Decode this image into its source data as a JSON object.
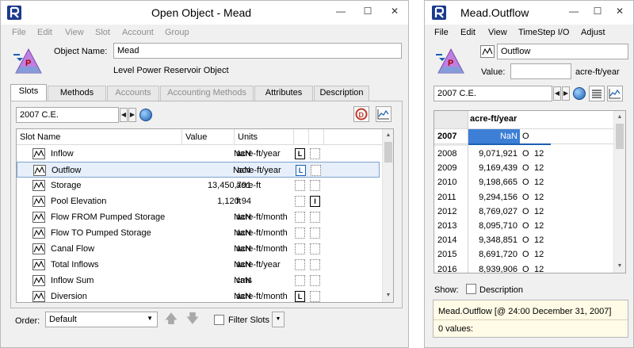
{
  "colors": {
    "accent": "#1a5fb0",
    "selection": "#e6effa",
    "status_bg": "#fffbe6",
    "object_icon_purple": "#c07fe0",
    "object_icon_blue": "#7aa0d8"
  },
  "main_window": {
    "title": "Open Object - Mead",
    "app_icon": "riverware-logo-icon",
    "menu": [
      "File",
      "Edit",
      "View",
      "Slot",
      "Account",
      "Group"
    ],
    "object_name_label": "Object Name:",
    "object_name_value": "Mead",
    "object_type": "Level Power Reservoir Object",
    "tabs": [
      "Slots",
      "Methods",
      "Accounts",
      "Accounting Methods",
      "Attributes",
      "Description"
    ],
    "active_tab": "Slots",
    "timestep": "2007 C.E.",
    "columns": [
      "Slot Name",
      "Value",
      "Units"
    ],
    "slots": [
      {
        "name": "Inflow",
        "value": "NaN",
        "units": "acre-ft/year",
        "flags": [
          "L",
          "e"
        ]
      },
      {
        "name": "Outflow",
        "value": "NaN",
        "units": "acre-ft/year",
        "flags": [
          "L",
          "e"
        ],
        "selected": true
      },
      {
        "name": "Storage",
        "value": "13,450,791",
        "units": "acre-ft",
        "flags": [
          "e",
          "e"
        ]
      },
      {
        "name": "Pool Elevation",
        "value": "1,120.94",
        "units": "ft",
        "flags": [
          "e",
          "I"
        ]
      },
      {
        "name": "Flow FROM Pumped Storage",
        "value": "NaN",
        "units": "acre-ft/month",
        "flags": [
          "e",
          "e"
        ]
      },
      {
        "name": "Flow TO Pumped Storage",
        "value": "NaN",
        "units": "acre-ft/month",
        "flags": [
          "e",
          "e"
        ]
      },
      {
        "name": "Canal Flow",
        "value": "NaN",
        "units": "acre-ft/month",
        "flags": [
          "e",
          "e"
        ]
      },
      {
        "name": "Total Inflows",
        "value": "NaN",
        "units": "acre-ft/year",
        "flags": [
          "e",
          "e"
        ]
      },
      {
        "name": "Inflow Sum",
        "value": "NaN",
        "units": "cms",
        "flags": [
          "e",
          "e"
        ]
      },
      {
        "name": "Diversion",
        "value": "NaN",
        "units": "acre-ft/month",
        "flags": [
          "L",
          "e"
        ]
      }
    ],
    "order_label": "Order:",
    "order_value": "Default",
    "filter_label": "Filter Slots"
  },
  "slot_window": {
    "title": "Mead.Outflow",
    "menu": [
      "File",
      "Edit",
      "View",
      "TimeStep I/O",
      "Adjust"
    ],
    "slot_name": "Outflow",
    "value_label": "Value:",
    "value_input": "",
    "units": "acre-ft/year",
    "timestep": "2007 C.E.",
    "column_header": "acre-ft/year",
    "current_row": {
      "year": "2007",
      "value": "NaN",
      "flag": "O"
    },
    "rows": [
      {
        "year": "2008",
        "value": "9,071,921",
        "flag": "O",
        "n": "12"
      },
      {
        "year": "2009",
        "value": "9,169,439",
        "flag": "O",
        "n": "12"
      },
      {
        "year": "2010",
        "value": "9,198,665",
        "flag": "O",
        "n": "12"
      },
      {
        "year": "2011",
        "value": "9,294,156",
        "flag": "O",
        "n": "12"
      },
      {
        "year": "2012",
        "value": "8,769,027",
        "flag": "O",
        "n": "12"
      },
      {
        "year": "2013",
        "value": "8,095,710",
        "flag": "O",
        "n": "12"
      },
      {
        "year": "2014",
        "value": "9,348,851",
        "flag": "O",
        "n": "12"
      },
      {
        "year": "2015",
        "value": "8,691,720",
        "flag": "O",
        "n": "12"
      },
      {
        "year": "2016",
        "value": "8,939,906",
        "flag": "O",
        "n": "12"
      }
    ],
    "show_label": "Show:",
    "description_label": "Description",
    "status_line": "Mead.Outflow [@ 24:00 December 31, 2007]",
    "values_count": "0 values:"
  }
}
